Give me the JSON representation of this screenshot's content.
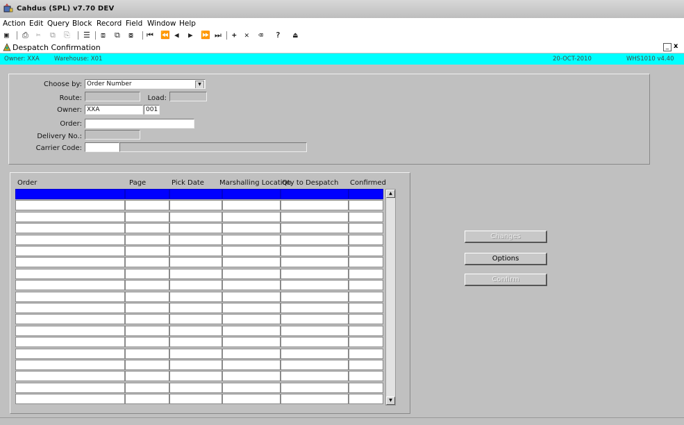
{
  "window": {
    "title": "Cahdus (SPL) v7.70 DEV"
  },
  "menu": [
    "Action",
    "Edit",
    "Query",
    "Block",
    "Record",
    "Field",
    "Window",
    "Help"
  ],
  "form": {
    "title": "Despatch Confirmation"
  },
  "info": {
    "owner_label": "Owner: XXA",
    "warehouse_label": "Warehouse: X01",
    "date": "20-OCT-2010",
    "version": "WHS1010 v4.40"
  },
  "filters": {
    "choose_by_label": "Choose by:",
    "choose_by_value": "Order Number",
    "route_label": "Route:",
    "load_label": "Load:",
    "owner_label": "Owner:",
    "owner_value": "XXA",
    "owner_code": "001",
    "order_label": "Order:",
    "delivery_label": "Delivery No.:",
    "carrier_label": "Carrier Code:"
  },
  "table": {
    "columns": [
      "Order",
      "Page",
      "Pick Date",
      "Marshalling Location",
      "Qty to Despatch",
      "Confirmed"
    ]
  },
  "buttons": {
    "changes": "Changes",
    "options": "Options",
    "confirm": "Confirm"
  }
}
